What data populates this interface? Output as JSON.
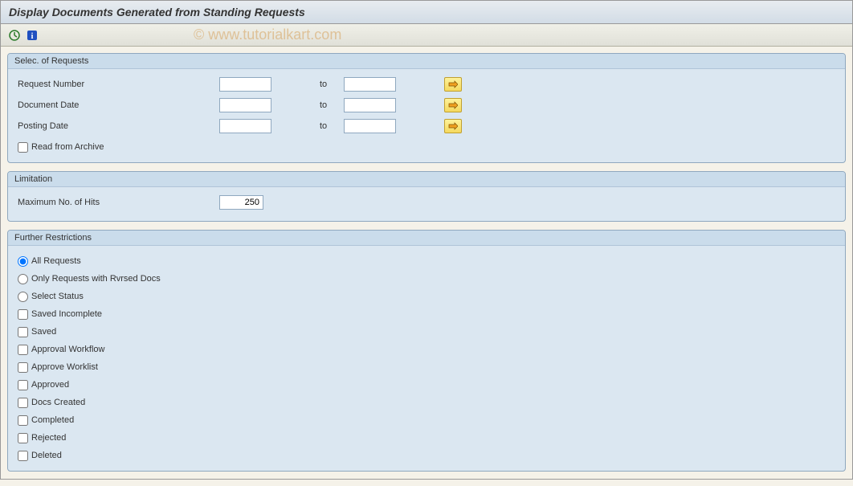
{
  "header": {
    "title": "Display Documents Generated from Standing Requests"
  },
  "watermark": "© www.tutorialkart.com",
  "group1": {
    "title": "Selec. of Requests",
    "rows": {
      "request_number": {
        "label": "Request Number",
        "to": "to"
      },
      "document_date": {
        "label": "Document Date",
        "to": "to"
      },
      "posting_date": {
        "label": "Posting Date",
        "to": "to"
      }
    },
    "read_archive": "Read from Archive"
  },
  "group2": {
    "title": "Limitation",
    "max_hits_label": "Maximum No. of Hits",
    "max_hits_value": "250"
  },
  "group3": {
    "title": "Further Restrictions",
    "radios": {
      "all": "All Requests",
      "rvrsed": "Only Requests with Rvrsed Docs",
      "select_status": "Select Status"
    },
    "checks": {
      "saved_incomplete": "Saved Incomplete",
      "saved": "Saved",
      "approval_workflow": "Approval Workflow",
      "approve_worklist": "Approve Worklist",
      "approved": "Approved",
      "docs_created": "Docs Created",
      "completed": "Completed",
      "rejected": "Rejected",
      "deleted": "Deleted"
    }
  }
}
